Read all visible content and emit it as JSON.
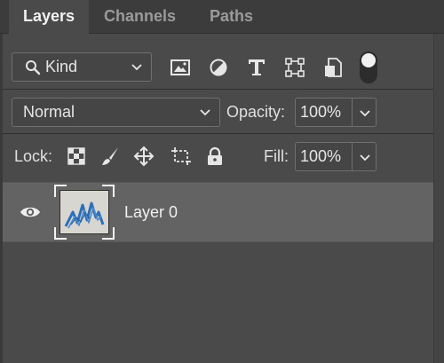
{
  "tabs": [
    {
      "label": "Layers",
      "active": true
    },
    {
      "label": "Channels",
      "active": false
    },
    {
      "label": "Paths",
      "active": false
    }
  ],
  "filter": {
    "kind_label": "Kind",
    "icons": [
      "search-icon",
      "chevron-down-icon",
      "image-filter-icon",
      "adjustment-filter-icon",
      "type-filter-icon",
      "shape-filter-icon",
      "smart-object-filter-icon"
    ],
    "toggle_on": true
  },
  "blend": {
    "mode": "Normal",
    "opacity_label": "Opacity:",
    "opacity_value": "100%"
  },
  "lock": {
    "label": "Lock:",
    "icons": [
      "lock-transparent-pixels-icon",
      "lock-image-pixels-icon",
      "lock-position-icon",
      "lock-artboard-icon",
      "lock-all-icon"
    ],
    "fill_label": "Fill:",
    "fill_value": "100%"
  },
  "layers": [
    {
      "name": "Layer 0",
      "visible": true,
      "thumbnail": "blue-scribble-mountains"
    }
  ],
  "colors": {
    "panel_bg": "#4a4a4a",
    "tab_bar_bg": "#3c3c3c",
    "selected_row": "#636363",
    "sketch_blue": "#2e6fb8"
  }
}
